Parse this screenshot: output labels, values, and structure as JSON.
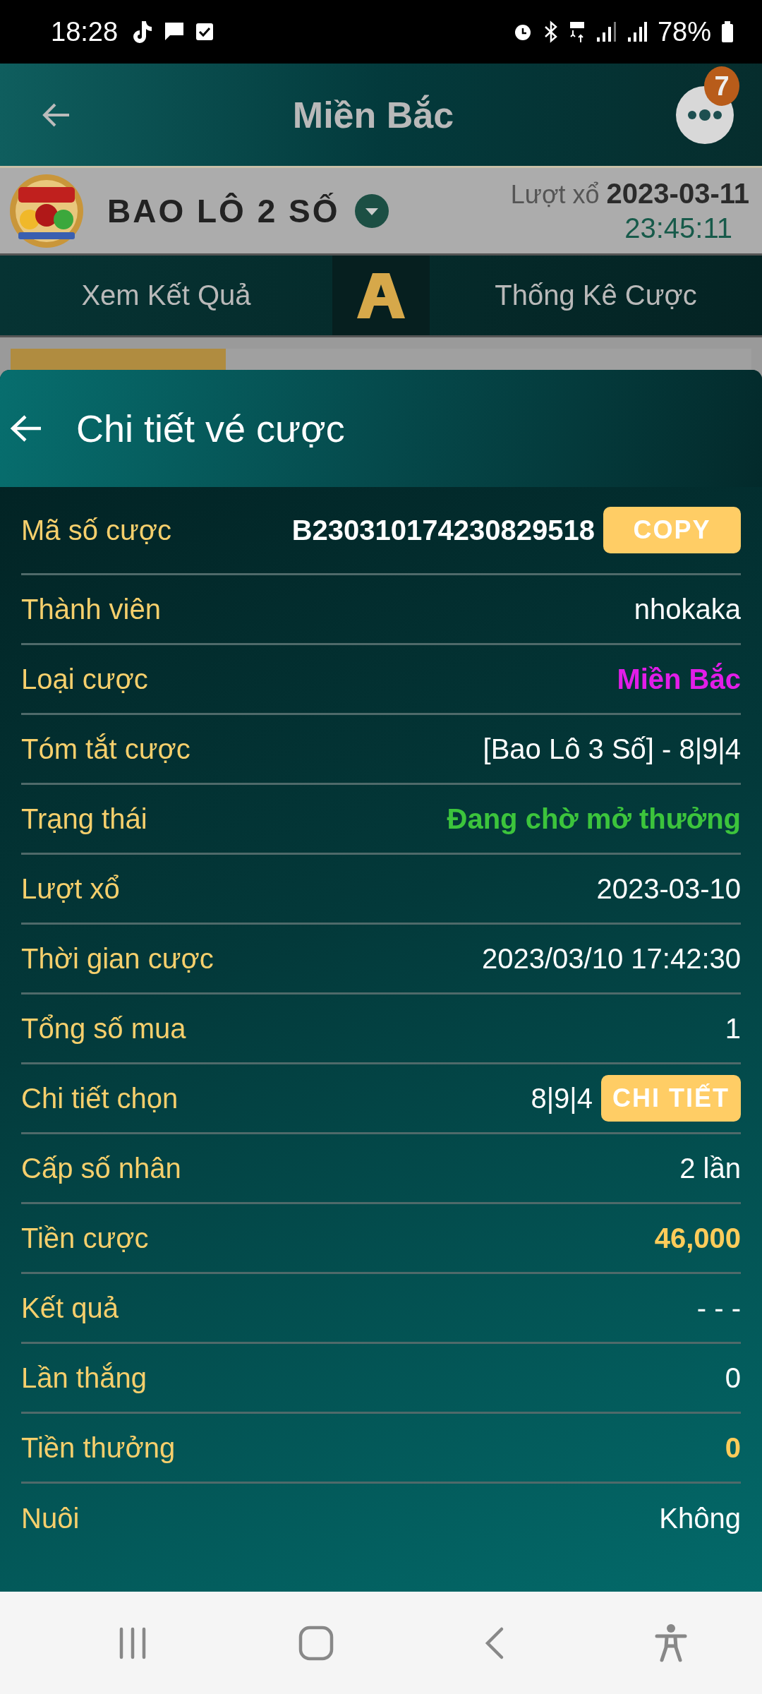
{
  "status_bar": {
    "time": "18:28",
    "battery": "78%"
  },
  "app_bar": {
    "title": "Miền Bắc",
    "badge": "7"
  },
  "game_bar": {
    "game": "BAO LÔ 2 SỐ",
    "draw_label": "Lượt xổ",
    "draw_date": "2023-03-11",
    "countdown": "23:45:11"
  },
  "tabs": [
    {
      "label": "Xem Kết Quả",
      "selected": false
    },
    {
      "label": "Thống Kê Cược",
      "selected": false
    }
  ],
  "progress": {
    "level": 0.29
  },
  "sheet": {
    "title": "Chi tiết vé cược",
    "rows": [
      {
        "label": "Mã số cược",
        "value": "B230310174230829518",
        "kind": "bold",
        "button": "COPY"
      },
      {
        "label": "Thành viên",
        "value": "nhokaka",
        "kind": "plain"
      },
      {
        "label": "Loại cược",
        "value": "Miền Bắc",
        "kind": "magenta"
      },
      {
        "label": "Tóm tắt cược",
        "value": "[Bao Lô 3 Số] - 8|9|4",
        "kind": "plain"
      },
      {
        "label": "Trạng thái",
        "value": "Đang chờ mở thưởng",
        "kind": "green"
      },
      {
        "label": "Lượt xổ",
        "value": "2023-03-10",
        "kind": "plain"
      },
      {
        "label": "Thời gian cược",
        "value": "2023/03/10 17:42:30",
        "kind": "plain"
      },
      {
        "label": "Tổng số mua",
        "value": "1",
        "kind": "plain"
      },
      {
        "label": "Chi tiết chọn",
        "value": "8|9|4",
        "kind": "plain",
        "button": "CHI TIẾT"
      },
      {
        "label": "Cấp số nhân",
        "value": "2 lần",
        "kind": "plain"
      },
      {
        "label": "Tiền cược",
        "value": "46,000",
        "kind": "gold"
      },
      {
        "label": "Kết quả",
        "value": "- - -",
        "kind": "plain"
      },
      {
        "label": "Lần thắng",
        "value": "0",
        "kind": "plain"
      },
      {
        "label": "Tiền thưởng",
        "value": "0",
        "kind": "gold"
      },
      {
        "label": "Nuôi",
        "value": "Không",
        "kind": "plain"
      }
    ]
  }
}
